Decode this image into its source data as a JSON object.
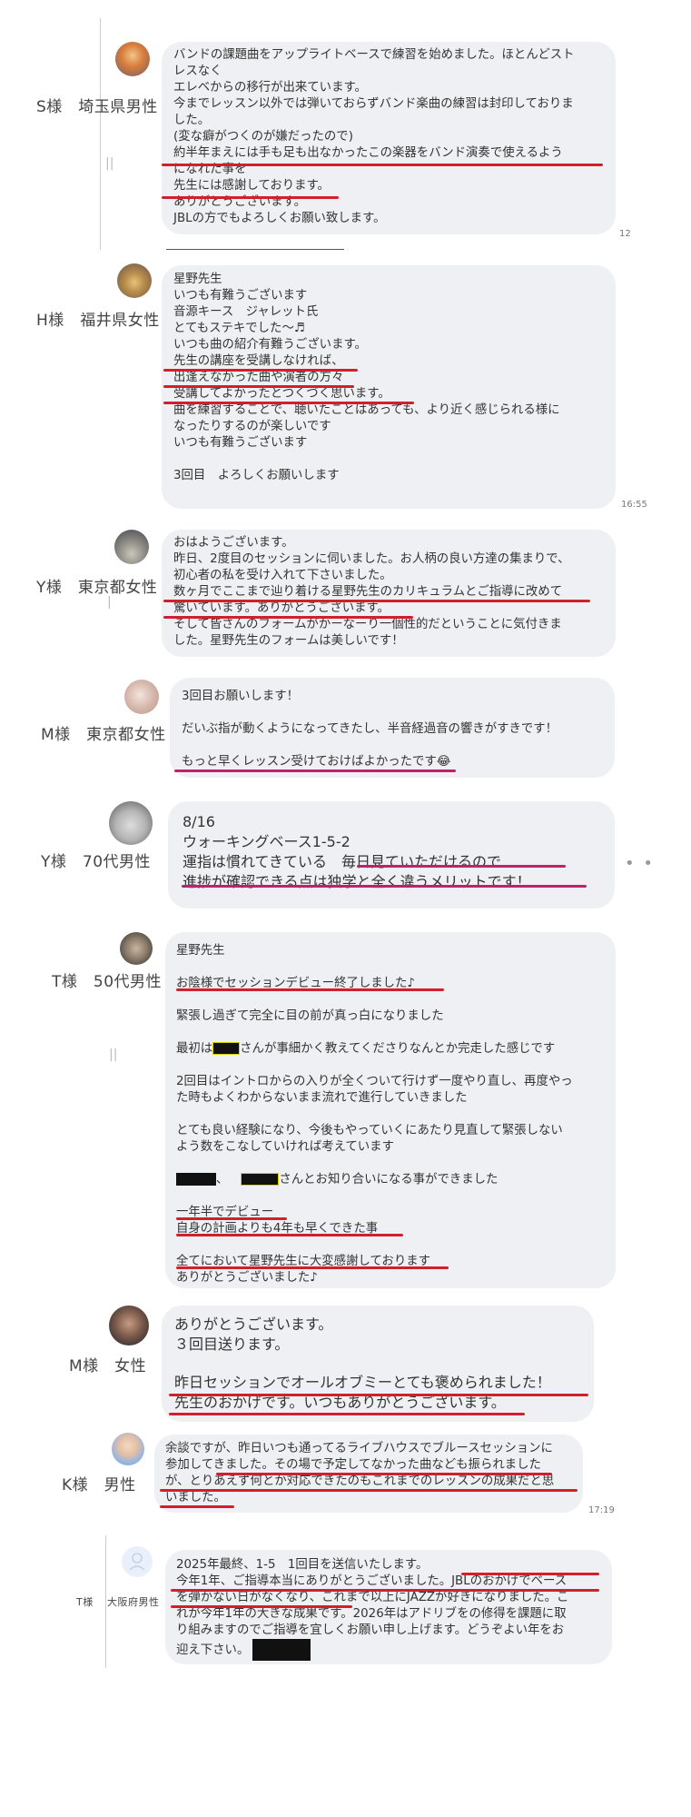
{
  "messages": [
    {
      "label": "S様　埼玉県男性",
      "lines": [
        "バンドの課題曲をアップライトベースで練習を始めました。ほとんどスト",
        "レスなく",
        "エレベからの移行が出来ています。",
        "今までレッスン以外では弾いておらずバンド楽曲の練習は封印しておりま",
        "した。",
        "(変な癖がつくのが嫌だったので)",
        "約半年まえには手も足も出なかったこの楽器をバンド演奏で使えるよう",
        "になれた事を",
        "先生には感謝しております。",
        "ありがとうございます。",
        "JBLの方でもよろしくお願い致します。"
      ],
      "time": "12"
    },
    {
      "label": "H様　福井県女性",
      "lines": [
        "星野先生",
        "いつも有難うございます",
        "音源キース　ジャレット氏",
        "とてもステキでした〜♬",
        "いつも曲の紹介有難うございます。",
        "先生の講座を受講しなければ、",
        "出逢えなかった曲や演者の方々",
        "受講してよかったとつくづく思います。",
        "曲を練習することで、聴いたことはあっても、より近く感じられる様に",
        "なったりするのが楽しいです",
        "いつも有難うございます",
        "",
        "3回目　よろしくお願いします"
      ],
      "time": "16:55"
    },
    {
      "label": "Y様　東京都女性",
      "lines": [
        "おはようございます。",
        "昨日、2度目のセッションに伺いました。お人柄の良い方達の集まりで、",
        "初心者の私を受け入れて下さいました。",
        "数ヶ月でここまで辿り着ける星野先生のカリキュラムとご指導に改めて",
        "驚いています。ありがとうございます。",
        "そして皆さんのフォームがかーなーり一個性的だということに気付きま",
        "した。星野先生のフォームは美しいです！"
      ]
    },
    {
      "label": "M様　東京都女性",
      "lines": [
        "3回目お願いします！",
        "",
        "だいぶ指が動くようになってきたし、半音経過音の響きがすきです！",
        "",
        "もっと早くレッスン受けておけばよかったです😂"
      ]
    },
    {
      "label": "Y様　70代男性",
      "lines": [
        "8/16",
        "ウォーキングベース1-5-2",
        "運指は慣れてきている　毎日見ていただけるので",
        "進捗が確認できる点は独学と全く違うメリットです！"
      ],
      "dots": "• •"
    },
    {
      "label": "T様　50代男性",
      "lines": [
        "星野先生",
        "",
        "お陰様でセッションデビュー終了しました♪",
        "",
        "緊張し過ぎて完全に目の前が真っ白になりました",
        "",
        "最初は",
        "",
        "2回目はイントロからの入りが全くついて行けず一度やり直し、再度やっ",
        "た時もよくわからないまま流れで進行していきました",
        "",
        "とても良い経験になり、今後もやっていくにあたり見直して緊張しない",
        "よう数をこなしていければ考えています",
        "",
        "さんとお知り合いになる事ができました",
        "",
        "一年半でデビュー",
        "自身の計画よりも4年も早くできた事",
        "",
        "全てにおいて星野先生に大変感謝しております",
        "ありがとうございました♪"
      ],
      "first_line_suffix": "さんが事細かく教えてくださりなんとか完走した感じです",
      "sep": "、"
    },
    {
      "label": "M様　女性",
      "lines": [
        "ありがとうございます。",
        "３回目送ります。",
        "",
        "昨日セッションでオールオブミーとても褒められました！",
        "先生のおかげです。いつもありがとうございます。"
      ]
    },
    {
      "label": "K様　男性",
      "lines": [
        "余談ですが、昨日いつも通ってるライブハウスでブルースセッションに",
        "参加してきました。その場で予定してなかった曲なども振られました",
        "が、とりあえず何とか対応できたのもこれまでのレッスンの成果だと思",
        "いました。"
      ],
      "time": "17:19"
    },
    {
      "label_name": "T様",
      "label_area": "大阪府男性",
      "lines": [
        "2025年最終、1-5　1回目を送信いたします。",
        "今年1年、ご指導本当にありがとうございました。JBLのおかげでベース",
        "を弾かない日がなくなり、これまで以上にJAZZが好きになりました。こ",
        "れが今年1年の大きな成果です。2026年はアドリブをの修得を課題に取",
        "り組みますのでご指導を宜しくお願い申し上げます。どうぞよい年をお",
        "迎え下さい。"
      ]
    }
  ],
  "colors": {
    "bubble": "#eef0f3",
    "underline": "#d21f2c",
    "underline_magenta": "#c0206c"
  }
}
